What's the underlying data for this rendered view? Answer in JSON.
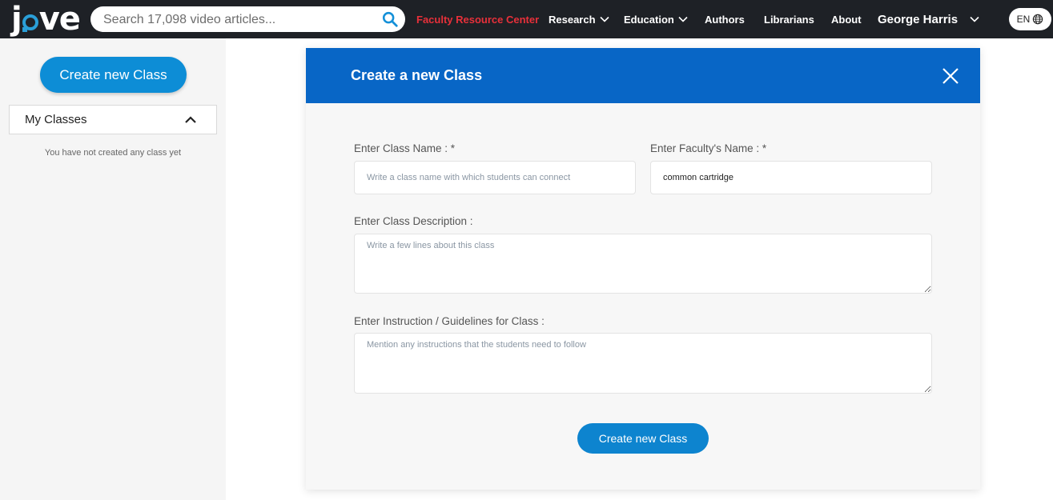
{
  "header": {
    "logo_text": "jove",
    "search": {
      "placeholder": "Search 17,098 video articles...",
      "value": ""
    },
    "nav": {
      "faculty": "Faculty Resource Center",
      "research": "Research",
      "education": "Education",
      "authors": "Authors",
      "librarians": "Librarians",
      "about": "About"
    },
    "user_name": "George Harris",
    "language": "EN"
  },
  "sidebar": {
    "create_button": "Create new Class",
    "my_classes_label": "My Classes",
    "empty_message": "You have not created any class yet"
  },
  "modal": {
    "title": "Create a new Class",
    "class_name": {
      "label": "Enter Class Name : *",
      "placeholder": "Write a class name with which students can connect",
      "value": ""
    },
    "faculty_name": {
      "label": "Enter Faculty's Name : *",
      "placeholder": "",
      "value": "common cartridge"
    },
    "description": {
      "label": "Enter Class Description :",
      "placeholder": "Write a few lines about this class",
      "value": ""
    },
    "instructions": {
      "label": "Enter Instruction / Guidelines for Class :",
      "placeholder": "Mention any instructions that the students need to follow",
      "value": ""
    },
    "submit_button": "Create new Class"
  },
  "colors": {
    "topbar_bg": "#1e2126",
    "brand_blue": "#0866c6",
    "button_blue": "#0d8dd6",
    "faculty_link": "#e8303a"
  },
  "icons": [
    "search-icon",
    "chevron-down-icon",
    "globe-icon",
    "chevron-up-icon",
    "close-icon"
  ]
}
